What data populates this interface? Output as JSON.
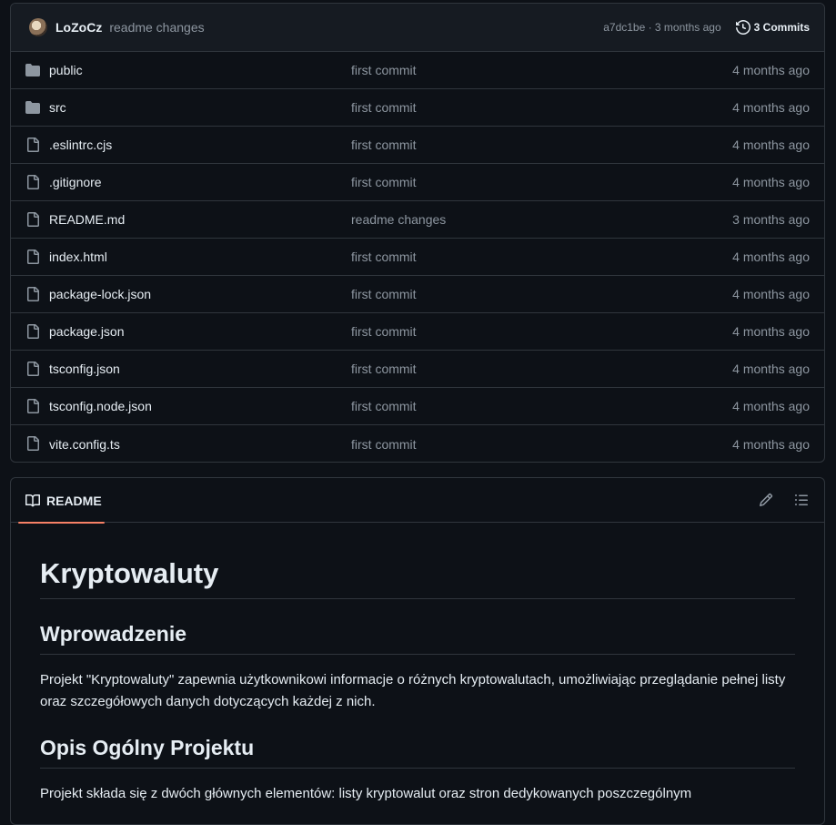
{
  "latest_commit": {
    "author": "LoZoCz",
    "message": "readme changes",
    "meta": "a7dc1be · 3 months ago",
    "commits_label": "3 Commits"
  },
  "files": [
    {
      "type": "folder",
      "name": "public",
      "commit": "first commit",
      "age": "4 months ago"
    },
    {
      "type": "folder",
      "name": "src",
      "commit": "first commit",
      "age": "4 months ago"
    },
    {
      "type": "file",
      "name": ".eslintrc.cjs",
      "commit": "first commit",
      "age": "4 months ago"
    },
    {
      "type": "file",
      "name": ".gitignore",
      "commit": "first commit",
      "age": "4 months ago"
    },
    {
      "type": "file",
      "name": "README.md",
      "commit": "readme changes",
      "age": "3 months ago"
    },
    {
      "type": "file",
      "name": "index.html",
      "commit": "first commit",
      "age": "4 months ago"
    },
    {
      "type": "file",
      "name": "package-lock.json",
      "commit": "first commit",
      "age": "4 months ago"
    },
    {
      "type": "file",
      "name": "package.json",
      "commit": "first commit",
      "age": "4 months ago"
    },
    {
      "type": "file",
      "name": "tsconfig.json",
      "commit": "first commit",
      "age": "4 months ago"
    },
    {
      "type": "file",
      "name": "tsconfig.node.json",
      "commit": "first commit",
      "age": "4 months ago"
    },
    {
      "type": "file",
      "name": "vite.config.ts",
      "commit": "first commit",
      "age": "4 months ago"
    }
  ],
  "readme": {
    "tab_label": "README",
    "title": "Kryptowaluty",
    "h2_intro": "Wprowadzenie",
    "p_intro": "Projekt \"Kryptowaluty\" zapewnia użytkownikowi informacje o różnych kryptowalutach, umożliwiając przeglądanie pełnej listy oraz szczegółowych danych dotyczących każdej z nich.",
    "h2_overview": "Opis Ogólny Projektu",
    "p_overview": "Projekt składa się z dwóch głównych elementów: listy kryptowalut oraz stron dedykowanych poszczególnym"
  },
  "icons": {
    "folder": "folder-icon",
    "file": "file-icon",
    "history": "history-icon",
    "book": "book-icon",
    "edit": "pencil-icon",
    "outline": "list-unordered-icon"
  },
  "colors": {
    "background": "#0d1117",
    "border": "#30363d",
    "muted_text": "#8d96a0",
    "tab_accent": "#f78166"
  }
}
